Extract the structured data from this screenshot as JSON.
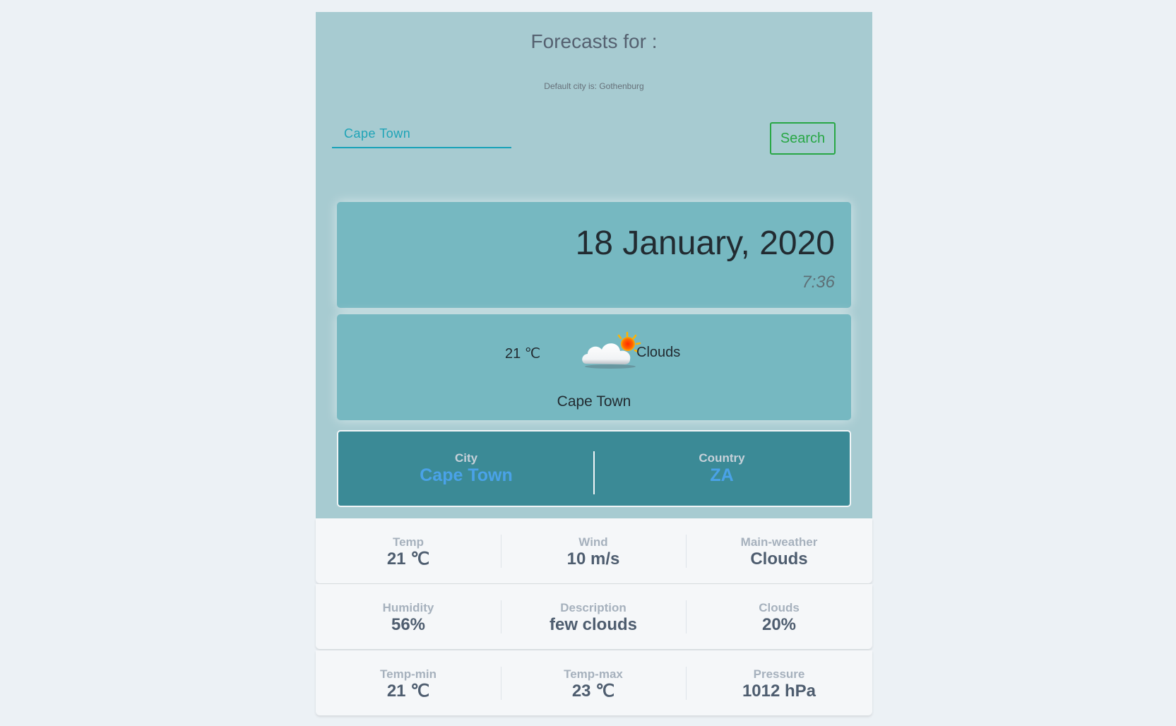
{
  "header": {
    "title": "Forecasts for :",
    "default_note": "Default city is: Gothenburg"
  },
  "search": {
    "value": "Cape Town",
    "button_label": "Search"
  },
  "date_card": {
    "date": "18 January, 2020",
    "time": "7:36"
  },
  "weather_card": {
    "temp": "21 ℃",
    "icon": "cloud-sun-icon",
    "main": "Clouds",
    "city": "Cape Town"
  },
  "location": {
    "city_label": "City",
    "city_value": "Cape Town",
    "country_label": "Country",
    "country_value": "ZA"
  },
  "stats": [
    [
      {
        "label": "Temp",
        "value": "21 ℃"
      },
      {
        "label": "Wind",
        "value": "10 m/s"
      },
      {
        "label": "Main-weather",
        "value": "Clouds"
      }
    ],
    [
      {
        "label": "Humidity",
        "value": "56%"
      },
      {
        "label": "Description",
        "value": "few clouds"
      },
      {
        "label": "Clouds",
        "value": "20%"
      }
    ],
    [
      {
        "label": "Temp-min",
        "value": "21 ℃"
      },
      {
        "label": "Temp-max",
        "value": "23 ℃"
      },
      {
        "label": "Pressure",
        "value": "1012 hPa"
      }
    ]
  ],
  "colors": {
    "panel": "#a7cbd1",
    "card": "#76b8c1",
    "location_card": "#3b8a96",
    "accent_blue": "#4aa2e8",
    "search_green": "#28a745",
    "input_teal": "#17a2b8"
  }
}
